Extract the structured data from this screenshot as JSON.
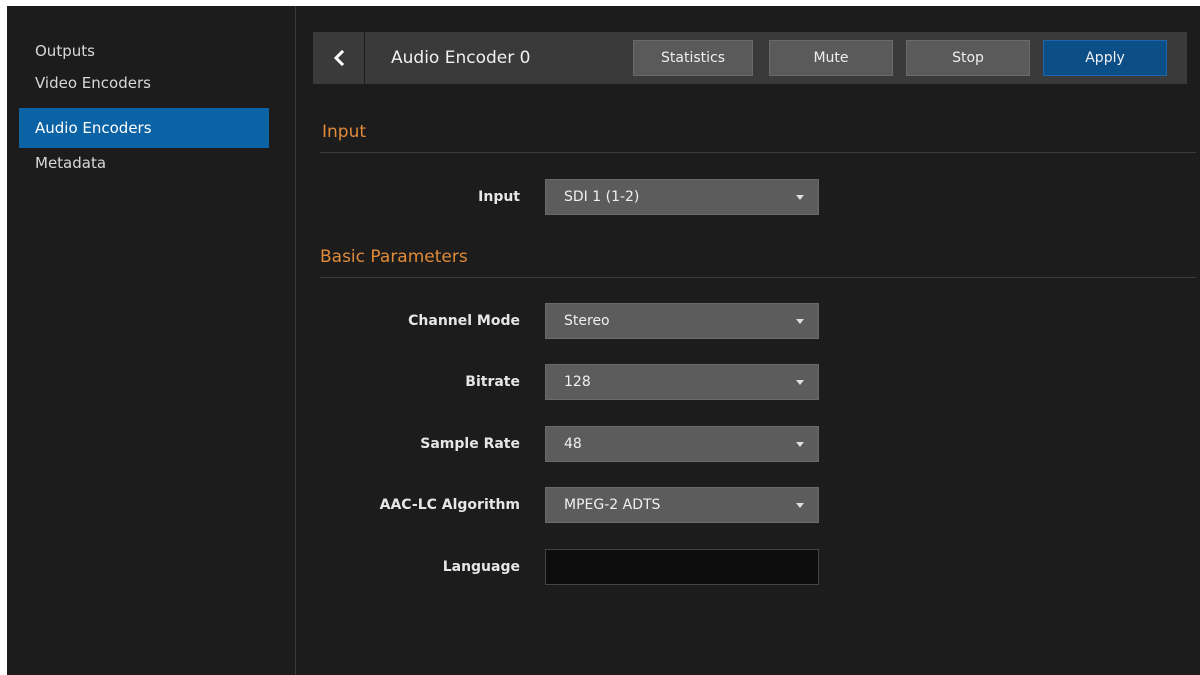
{
  "sidebar": {
    "items": [
      {
        "label": "Outputs"
      },
      {
        "label": "Video Encoders"
      },
      {
        "label": "Audio Encoders",
        "active": true
      },
      {
        "label": "Metadata"
      }
    ]
  },
  "header": {
    "title": "Audio Encoder 0",
    "back_icon": "chevron-left-icon",
    "buttons": {
      "statistics": "Statistics",
      "mute": "Mute",
      "stop": "Stop",
      "apply": "Apply"
    }
  },
  "input_section": {
    "title": "Input",
    "input": {
      "label": "Input",
      "value": "SDI 1 (1-2)"
    }
  },
  "basic_section": {
    "title": "Basic Parameters",
    "channel_mode": {
      "label": "Channel Mode",
      "value": "Stereo"
    },
    "bitrate": {
      "label": "Bitrate",
      "value": "128"
    },
    "sample_rate": {
      "label": "Sample Rate",
      "value": "48"
    },
    "aac_lc_algorithm": {
      "label": "AAC-LC Algorithm",
      "value": "MPEG-2 ADTS"
    },
    "language": {
      "label": "Language",
      "value": ""
    }
  },
  "colors": {
    "background": "#1c1c1c",
    "accent_active": "#0b62a4",
    "section_title": "#e08a3a",
    "apply_button": "#0b4f86"
  }
}
